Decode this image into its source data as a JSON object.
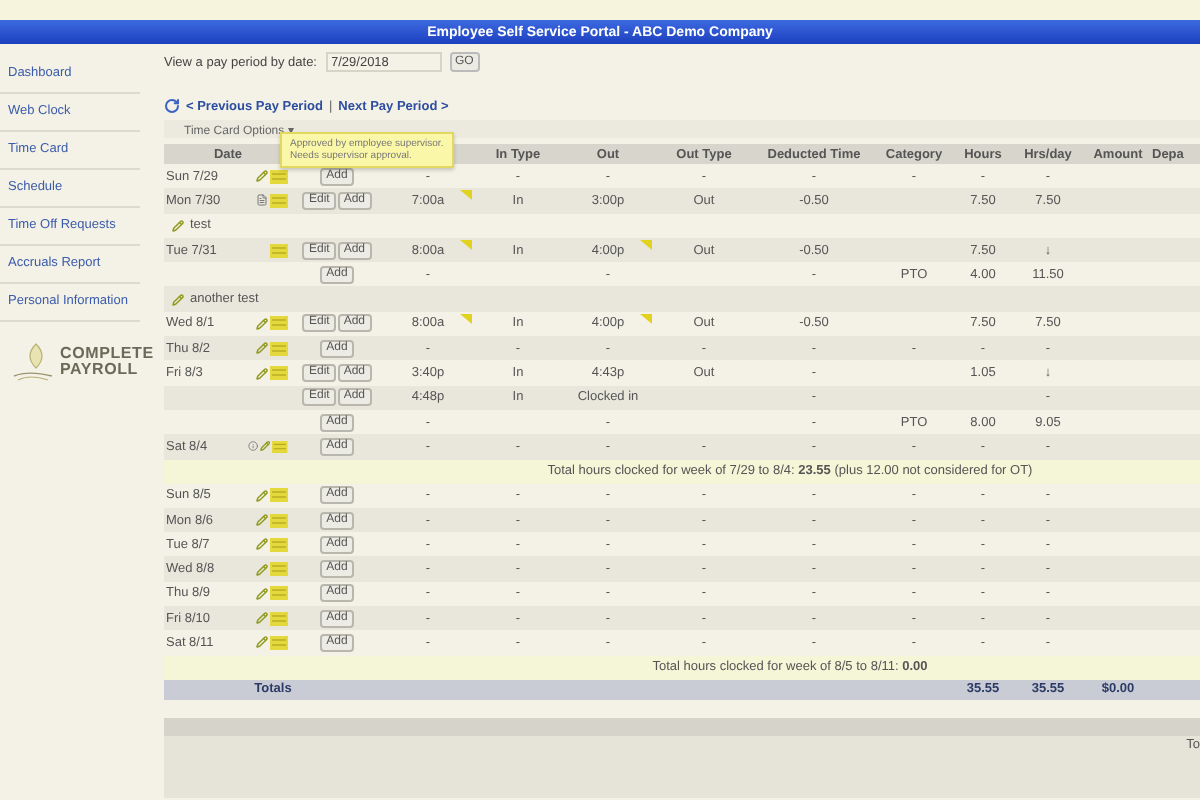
{
  "window": {
    "title": "Employee Self Service Portal - ABC Demo Company"
  },
  "sidebar": {
    "items": [
      "Dashboard",
      "Web Clock",
      "Time Card",
      "Schedule",
      "Time Off Requests",
      "Accruals Report",
      "Personal Information"
    ],
    "logo": {
      "lines": [
        "COMPLETE",
        "PAYROLL"
      ]
    }
  },
  "period": {
    "label": "View a pay period by date:",
    "value": "7/29/2018",
    "button": "GO"
  },
  "nav": {
    "previous": "< Previous Pay Period",
    "separator": "|",
    "next": "Next Pay Period >"
  },
  "options": {
    "label": "Time Card Options ▾"
  },
  "tooltip": {
    "lines": [
      "Approved by employee supervisor.",
      "Needs supervisor approval."
    ]
  },
  "table": {
    "columns": [
      {
        "label": "Date"
      },
      {},
      {
        "label": "In Type"
      },
      {
        "label": "Out"
      },
      {
        "label": "Out Type"
      },
      {
        "label": "Deducted Time"
      },
      {
        "label": "Category"
      },
      {
        "label": "Hours"
      },
      {
        "label": "Hrs/day"
      },
      {
        "label": "Amount"
      },
      {
        "label": "Depa"
      }
    ],
    "rows": [
      {
        "kind": "day",
        "date": "Sun 7/29",
        "icons": [
          {
            "kind": "pencil"
          },
          {
            "kind": "note"
          }
        ],
        "buttons": [
          "Add"
        ],
        "in_flag": false,
        "out_flag": false,
        "cells": [
          "-",
          "-",
          "-",
          "-",
          "-",
          "-",
          "-",
          "-"
        ]
      },
      {
        "kind": "day",
        "date": "Mon 7/30",
        "icons": [
          {
            "kind": "detail"
          },
          {
            "kind": "note"
          }
        ],
        "buttons": [
          "Edit",
          "Add"
        ],
        "in_flag": true,
        "out_flag": false,
        "cells": [
          "7:00a",
          "In",
          "3:00p",
          "Out",
          "-0.50",
          null,
          "7.50",
          "7.50"
        ]
      },
      {
        "kind": "comment",
        "text": "test"
      },
      {
        "kind": "day",
        "date": "Tue 7/31",
        "icons": [
          {
            "kind": "note"
          }
        ],
        "buttons": [
          "Edit",
          "Add"
        ],
        "in_flag": true,
        "out_flag": true,
        "cells": [
          "8:00a",
          "In",
          "4:00p",
          "Out",
          "-0.50",
          null,
          "7.50",
          "↓"
        ]
      },
      {
        "kind": "day",
        "icons": [],
        "buttons": [
          "Add"
        ],
        "in_flag": false,
        "out_flag": false,
        "cells": [
          "-",
          null,
          "-",
          null,
          "-",
          "PTO",
          "4.00",
          "11.50"
        ]
      },
      {
        "kind": "comment",
        "text": "another test"
      },
      {
        "kind": "day",
        "date": "Wed 8/1",
        "icons": [
          {
            "kind": "pencil"
          },
          {
            "kind": "note"
          }
        ],
        "buttons": [
          "Edit",
          "Add"
        ],
        "in_flag": true,
        "out_flag": true,
        "cells": [
          "8:00a",
          "In",
          "4:00p",
          "Out",
          "-0.50",
          null,
          "7.50",
          "7.50"
        ]
      },
      {
        "kind": "day",
        "date": "Thu 8/2",
        "icons": [
          {
            "kind": "pencil"
          },
          {
            "kind": "note"
          }
        ],
        "buttons": [
          "Add"
        ],
        "in_flag": false,
        "out_flag": false,
        "cells": [
          "-",
          "-",
          "-",
          "-",
          "-",
          "-",
          "-",
          "-"
        ]
      },
      {
        "kind": "day",
        "date": "Fri 8/3",
        "icons": [
          {
            "kind": "pencil"
          },
          {
            "kind": "note"
          }
        ],
        "buttons": [
          "Edit",
          "Add"
        ],
        "in_flag": false,
        "out_flag": false,
        "cells": [
          "3:40p",
          "In",
          "4:43p",
          "Out",
          "-",
          null,
          "1.05",
          "↓"
        ]
      },
      {
        "kind": "day",
        "icons": [],
        "buttons": [
          "Edit",
          "Add"
        ],
        "in_flag": false,
        "out_flag": false,
        "cells": [
          "4:48p",
          "In",
          "Clocked in",
          null,
          "-",
          null,
          null,
          "-"
        ]
      },
      {
        "kind": "day",
        "icons": [],
        "buttons": [
          "Add"
        ],
        "in_flag": false,
        "out_flag": false,
        "cells": [
          "-",
          null,
          "-",
          null,
          "-",
          "PTO",
          "8.00",
          "9.05"
        ]
      },
      {
        "kind": "day",
        "date": "Sat 8/4",
        "icons": [
          {
            "kind": "info"
          },
          {
            "kind": "pencil"
          },
          {
            "kind": "note"
          }
        ],
        "buttons": [
          "Add"
        ],
        "in_flag": false,
        "out_flag": false,
        "cells": [
          "-",
          "-",
          "-",
          "-",
          "-",
          "-",
          "-",
          "-"
        ]
      },
      {
        "kind": "week_total",
        "text": "Total hours clocked for week of 7/29 to 8/4: **23.55** (plus 12.00 not considered for OT)"
      },
      {
        "kind": "day",
        "date": "Sun 8/5",
        "icons": [
          {
            "kind": "pencil"
          },
          {
            "kind": "note"
          }
        ],
        "buttons": [
          "Add"
        ],
        "in_flag": false,
        "out_flag": false,
        "cells": [
          "-",
          "-",
          "-",
          "-",
          "-",
          "-",
          "-",
          "-"
        ]
      },
      {
        "kind": "day",
        "date": "Mon 8/6",
        "icons": [
          {
            "kind": "pencil"
          },
          {
            "kind": "note"
          }
        ],
        "buttons": [
          "Add"
        ],
        "in_flag": false,
        "out_flag": false,
        "cells": [
          "-",
          "-",
          "-",
          "-",
          "-",
          "-",
          "-",
          "-"
        ]
      },
      {
        "kind": "day",
        "date": "Tue 8/7",
        "icons": [
          {
            "kind": "pencil"
          },
          {
            "kind": "note"
          }
        ],
        "buttons": [
          "Add"
        ],
        "in_flag": false,
        "out_flag": false,
        "cells": [
          "-",
          "-",
          "-",
          "-",
          "-",
          "-",
          "-",
          "-"
        ]
      },
      {
        "kind": "day",
        "date": "Wed 8/8",
        "icons": [
          {
            "kind": "pencil"
          },
          {
            "kind": "note"
          }
        ],
        "buttons": [
          "Add"
        ],
        "in_flag": false,
        "out_flag": false,
        "cells": [
          "-",
          "-",
          "-",
          "-",
          "-",
          "-",
          "-",
          "-"
        ]
      },
      {
        "kind": "day",
        "date": "Thu 8/9",
        "icons": [
          {
            "kind": "pencil"
          },
          {
            "kind": "note"
          }
        ],
        "buttons": [
          "Add"
        ],
        "in_flag": false,
        "out_flag": false,
        "cells": [
          "-",
          "-",
          "-",
          "-",
          "-",
          "-",
          "-",
          "-"
        ]
      },
      {
        "kind": "day",
        "date": "Fri 8/10",
        "icons": [
          {
            "kind": "pencil"
          },
          {
            "kind": "note"
          }
        ],
        "buttons": [
          "Add"
        ],
        "in_flag": false,
        "out_flag": false,
        "cells": [
          "-",
          "-",
          "-",
          "-",
          "-",
          "-",
          "-",
          "-"
        ]
      },
      {
        "kind": "day",
        "date": "Sat 8/11",
        "icons": [
          {
            "kind": "pencil"
          },
          {
            "kind": "note"
          }
        ],
        "buttons": [
          "Add"
        ],
        "in_flag": false,
        "out_flag": false,
        "cells": [
          "-",
          "-",
          "-",
          "-",
          "-",
          "-",
          "-",
          "-"
        ]
      },
      {
        "kind": "week_total",
        "text": "Total hours clocked for week of 8/5 to 8/11: **0.00**"
      },
      {
        "kind": "totals",
        "label": "Totals",
        "hours": "35.55",
        "hrs_day": "35.55",
        "amount": "$0.00"
      }
    ]
  },
  "summary": {
    "text": "To"
  }
}
